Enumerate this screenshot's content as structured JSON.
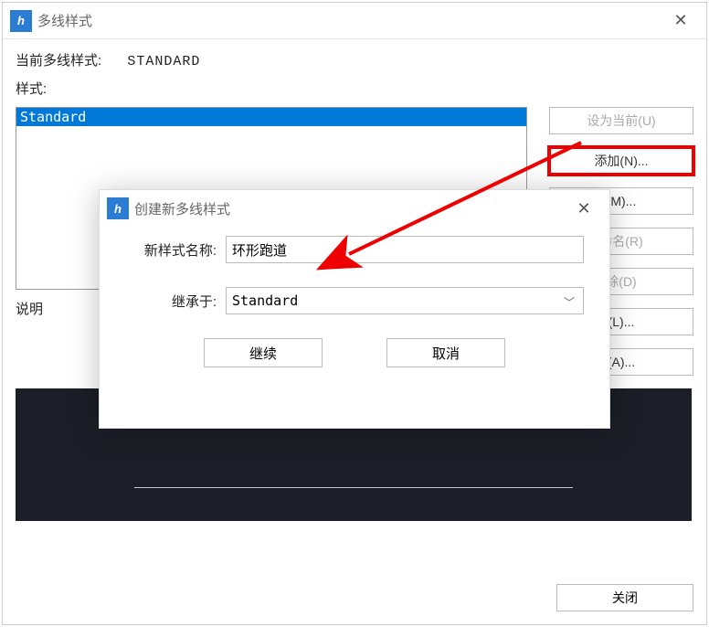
{
  "main": {
    "title": "多线样式",
    "current_label": "当前多线样式:",
    "current_value": "STANDARD",
    "styles_label": "样式:",
    "list_items": [
      "Standard"
    ],
    "selected_index": 0,
    "desc_label": "说明",
    "buttons": {
      "set_current": "设为当前(U)",
      "add": "添加(N)...",
      "modify": "修改(M)...",
      "rename": "重命名(R)",
      "delete": "删除(D)",
      "load": "加载(L)...",
      "save": "保存(A)...",
      "close": "关闭"
    },
    "button_partial": {
      "modify": "(M)...",
      "rename": "命名(R)",
      "delete": "除(D)",
      "load": "(L)...",
      "save": "(A)..."
    }
  },
  "inner": {
    "title": "创建新多线样式",
    "name_label": "新样式名称:",
    "name_value": "环形跑道",
    "inherit_label": "继承于:",
    "inherit_value": "Standard",
    "continue": "继续",
    "cancel": "取消"
  },
  "icons": {
    "app": "h",
    "close": "✕",
    "chevron": "﹀"
  }
}
